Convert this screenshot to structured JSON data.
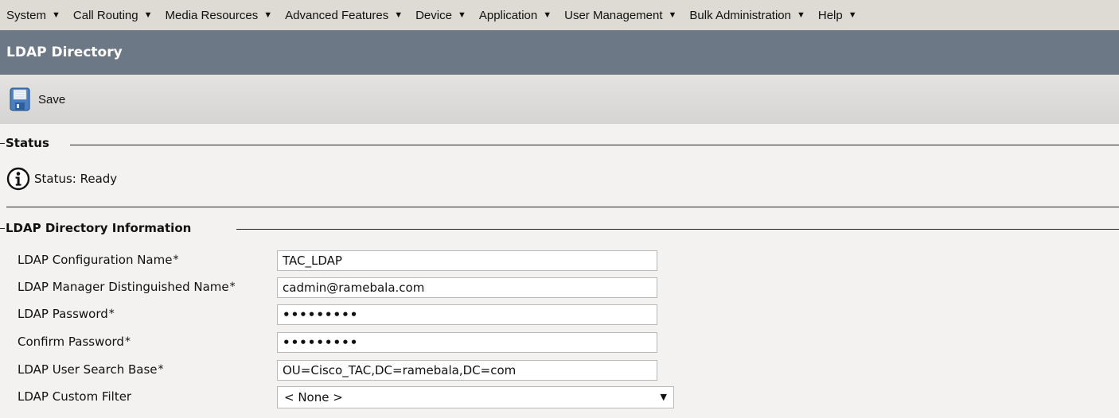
{
  "menu": [
    {
      "label": "System"
    },
    {
      "label": "Call Routing"
    },
    {
      "label": "Media Resources"
    },
    {
      "label": "Advanced Features"
    },
    {
      "label": "Device"
    },
    {
      "label": "Application"
    },
    {
      "label": "User Management"
    },
    {
      "label": "Bulk Administration"
    },
    {
      "label": "Help"
    }
  ],
  "menu_arrow": "▼",
  "page_title": "LDAP Directory",
  "toolbar": {
    "save_label": "Save",
    "save_icon": "floppy-disk-icon"
  },
  "status": {
    "legend": "Status",
    "icon": "info-icon",
    "text": "Status: Ready"
  },
  "ldap_info": {
    "legend": "LDAP Directory Information",
    "required_marker": "*",
    "fields": [
      {
        "label": "LDAP Configuration Name",
        "value": "TAC_LDAP",
        "required": true
      },
      {
        "label": "LDAP Manager Distinguished Name",
        "value": "cadmin@ramebala.com",
        "required": true
      },
      {
        "label": "LDAP Password",
        "value": "•••••••••",
        "required": true
      },
      {
        "label": "Confirm Password",
        "value": "•••••••••",
        "required": true
      },
      {
        "label": "LDAP User Search Base",
        "value": "OU=Cisco_TAC,DC=ramebala,DC=com",
        "required": true
      }
    ],
    "custom_filter": {
      "label": "LDAP Custom Filter",
      "selected": "< None >"
    }
  },
  "colors": {
    "menubar_bg": "#dedbd5",
    "titlebar_bg": "#6c7886",
    "page_bg": "#f3f2f0"
  }
}
